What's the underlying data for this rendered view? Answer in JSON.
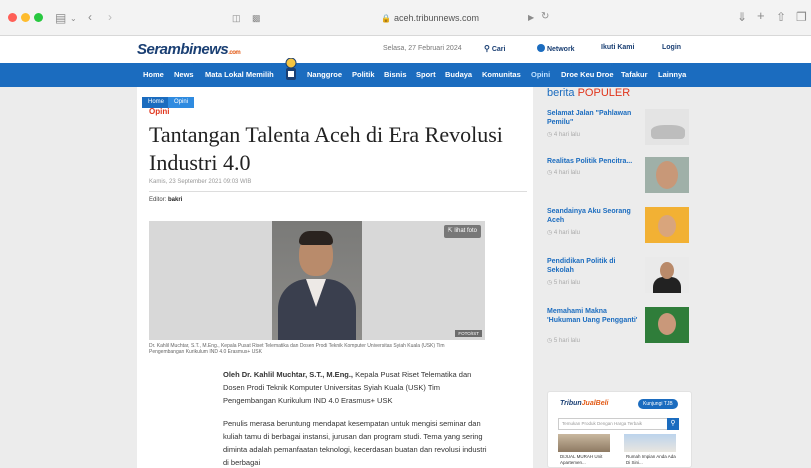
{
  "browser": {
    "url": "aceh.tribunnews.com",
    "icons": [
      "sidebar-icon",
      "back-icon",
      "forward-icon",
      "shield-icon",
      "reader-icon",
      "lock-icon",
      "translate-icon",
      "reload-icon",
      "download-icon",
      "new-tab-icon",
      "share-icon",
      "tabs-icon"
    ]
  },
  "site": {
    "logo": "Serambinews",
    "logo_suffix": ".com",
    "date": "Selasa, 27 Februari 2024",
    "search_label": "Cari",
    "network_label": "Network",
    "follow_label": "Ikuti Kami",
    "login_label": "Login"
  },
  "nav": {
    "items": [
      "Home",
      "News",
      "Mata Lokal Memilih",
      "Nanggroe",
      "Politik",
      "Bisnis",
      "Sport",
      "Budaya",
      "Komunitas",
      "Opini",
      "Droe Keu Droe",
      "Tafakur",
      "Lainnya"
    ]
  },
  "breadcrumb": [
    "Home",
    "Opini"
  ],
  "article": {
    "kicker": "Opini",
    "title": "Tantangan Talenta Aceh di Era Revolusi Industri 4.0",
    "date": "Kamis, 23 September 2021 09:03 WIB",
    "editor_label": "Editor:",
    "editor_name": "bakri",
    "photo_button": "lihat foto",
    "photo_credit": "FOTO/IST",
    "caption": "Dr. Kahlil Muchtar, S.T., M.Eng., Kepala Pusat Riset Telematika dan Dosen Prodi Teknik Komputer Universitas Syiah Kuala (USK) Tim Pengembangan Kurikulum IND 4.0 Erasmus+ USK",
    "byline_strong": "Oleh Dr. Kahlil Muchtar, S.T., M.Eng.,",
    "byline_rest": " Kepala Pusat Riset Telematika dan Dosen Prodi Teknik Komputer Universitas Syiah Kuala (USK) Tim Pengembangan Kurikulum IND 4.0 Erasmus+ USK",
    "body": "Penulis merasa beruntung mendapat kesempatan untuk mengisi seminar dan kuliah tamu di berbagai instansi, jurusan dan program studi. Tema yang sering diminta adalah pemanfaatan teknologi, kecerdasan buatan dan revolusi industri di berbagai"
  },
  "popular": {
    "title_a": "berita",
    "title_b": "POPULER",
    "items": [
      {
        "title": "Selamat Jalan \"Pahlawan Pemilu\"",
        "time": "4 hari lalu"
      },
      {
        "title": "Realitas Politik Pencitra...",
        "time": "4 hari lalu"
      },
      {
        "title": "Seandainya Aku Seorang Aceh",
        "time": "4 hari lalu"
      },
      {
        "title": "Pendidikan Politik di Sekolah",
        "time": "5 hari lalu"
      },
      {
        "title": "Memahami Makna 'Hukuman Uang Pengganti'",
        "time": "5 hari lalu"
      }
    ]
  },
  "ad": {
    "logo_a": "Tribun",
    "logo_b": "JualBeli",
    "button": "Kunjungi TJB",
    "search_placeholder": "Temukan Produk Dengan Harga Terbaik",
    "products": [
      {
        "title": "DIJUAL MURAH Unit Apartemen..."
      },
      {
        "title": "Rumah Impian Anda Ada Di Sini..."
      }
    ]
  }
}
